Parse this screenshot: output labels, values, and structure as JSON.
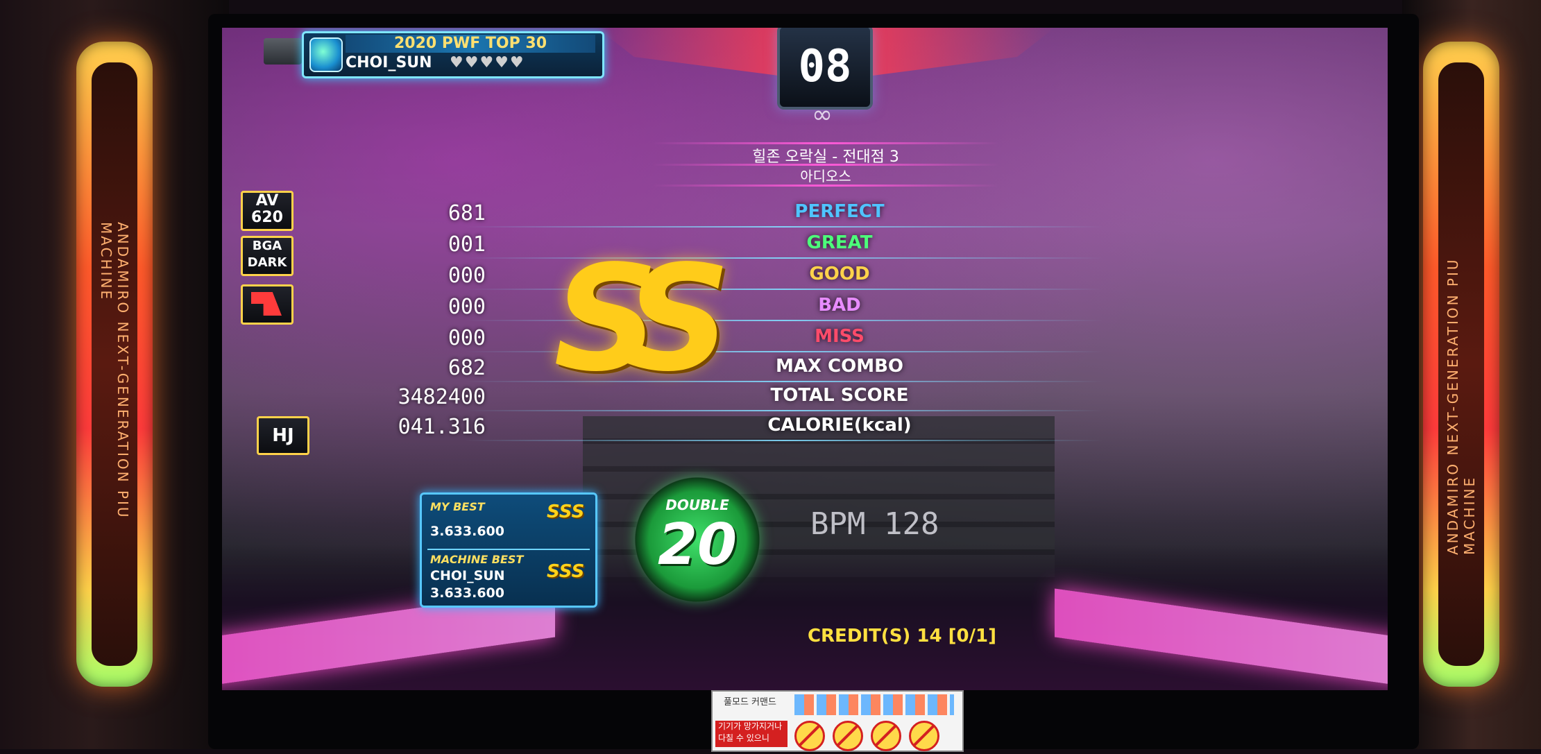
{
  "cabinet": {
    "side_text": "ANDAMIRO NEXT-GENERATION PIU MACHINE"
  },
  "header": {
    "title": "2020 PWF TOP 30",
    "player_name": "CHOI_SUN",
    "hearts": "♥♥♥♥♥",
    "stage": "08"
  },
  "song": {
    "title": "힐존 오락실 - 전대점 3",
    "artist": "아디오스"
  },
  "badges": {
    "av_label": "AV",
    "av_value": "620",
    "bga_line1": "BGA",
    "bga_line2": "DARK",
    "hj": "HJ"
  },
  "results": [
    {
      "label": "PERFECT",
      "value": "681",
      "color": "#4fc4ff"
    },
    {
      "label": "GREAT",
      "value": "001",
      "color": "#4cff7a"
    },
    {
      "label": "GOOD",
      "value": "000",
      "color": "#ffd34a"
    },
    {
      "label": "BAD",
      "value": "000",
      "color": "#e88cff"
    },
    {
      "label": "MISS",
      "value": "000",
      "color": "#ff4b6a"
    },
    {
      "label": "MAX COMBO",
      "value": "682",
      "color": "#ffffff"
    },
    {
      "label": "TOTAL SCORE",
      "value": "3482400",
      "color": "#ffffff"
    },
    {
      "label": "CALORIE(kcal)",
      "value": "041.316",
      "color": "#ffffff"
    }
  ],
  "grade": "SS",
  "best": {
    "my_best_label": "MY BEST",
    "my_best_score": "3.633.600",
    "my_best_grade": "SSS",
    "machine_best_label": "MACHINE BEST",
    "machine_best_player": "CHOI_SUN",
    "machine_best_score": "3.633.600",
    "machine_best_grade": "SSS"
  },
  "level": {
    "mode": "DOUBLE",
    "number": "20"
  },
  "bpm": "BPM 128",
  "credit": "CREDIT(S) 14 [0/1]",
  "sticker": {
    "heading": "풀모드 커맨드",
    "warning": "기기가 망가지거나 다칠 수 있으니"
  }
}
